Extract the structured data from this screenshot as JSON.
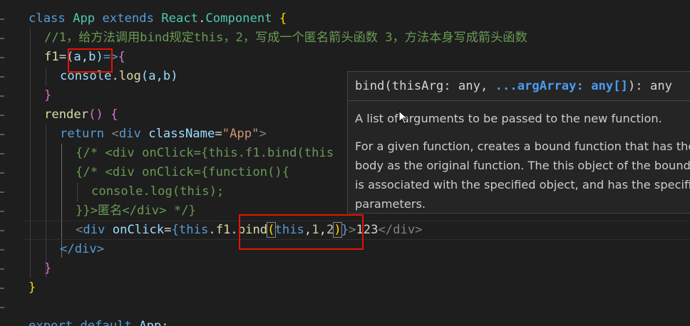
{
  "editor": {
    "lines": {
      "l1": {
        "kw_class": "class",
        "name": "App",
        "kw_extends": "extends",
        "react": "React",
        "dot": ".",
        "component": "Component",
        "brace": "{"
      },
      "l2": {
        "comment": "//1，给方法调用bind规定this，2，写成一个匿名箭头函数 3，方法本身写成箭头函数"
      },
      "l3": {
        "name": "f1",
        "eq": "=",
        "params": "(a,b)",
        "arrow": "=>",
        "brace": "{"
      },
      "l4": {
        "obj": "console",
        "dot": ".",
        "method": "log",
        "args": "(a,b)"
      },
      "l5": {
        "brace": "}"
      },
      "l6": {
        "name": "render",
        "parens": "()",
        "brace": "{"
      },
      "l7": {
        "kw_return": "return",
        "lt": "<",
        "tag": "div",
        "attr": "className",
        "eq": "=",
        "str": "\"App\"",
        "gt": ">"
      },
      "l8": {
        "text": "{/* <div onClick={this.f1.bind(this"
      },
      "l9": {
        "text": "{/* <div onClick={function(){"
      },
      "l10": {
        "text": "console.log(this);"
      },
      "l11": {
        "text": "}}>匿名</div> */}"
      },
      "l12": {
        "lt": "<",
        "tag": "div",
        "attr": "onClick",
        "eq": "=",
        "open": "{",
        "this1": "this",
        "dot1": ".",
        "f1": "f1",
        "dot2": ".",
        "bind": "bind",
        "paren_open": "(",
        "this2": "this",
        "comma1": ",",
        "n1": "1",
        "comma2": ",",
        "n2": "2",
        "paren_close": ")",
        "close": "}",
        "gt": ">",
        "content": "123",
        "close_tag": "</div>"
      },
      "l13": {
        "text": "</div>"
      },
      "l14": {
        "brace": "}"
      },
      "l15": {
        "brace": "}"
      },
      "l16": {
        "kw_export": "export",
        "kw_default": "default",
        "name": "App",
        "semi": ";"
      }
    }
  },
  "hover": {
    "signature": {
      "fn": "bind",
      "open": "(",
      "p1_name": "thisArg",
      "p1_colon": ": ",
      "p1_type": "any",
      "comma": ", ",
      "p2_name": "...argArray",
      "p2_colon": ": ",
      "p2_type": "any[]",
      "close": "): ",
      "ret": "any"
    },
    "doc1": "A list of arguments to be passed to the new function.",
    "doc2_l1": "For a given function, creates a bound function that has the same",
    "doc2_l2": "body as the original function. The this object of the bound function",
    "doc2_l3": "is associated with the specified object, and has the specified initial",
    "doc2_l4": "parameters."
  },
  "colors": {
    "background": "#1e1e1e",
    "keyword": "#569cd6",
    "class_name": "#4ec9b0",
    "function": "#dcdcaa",
    "variable": "#9cdcfe",
    "string": "#ce9178",
    "number": "#b5cea8",
    "comment": "#6a9955",
    "highlight_box": "#e51400"
  }
}
